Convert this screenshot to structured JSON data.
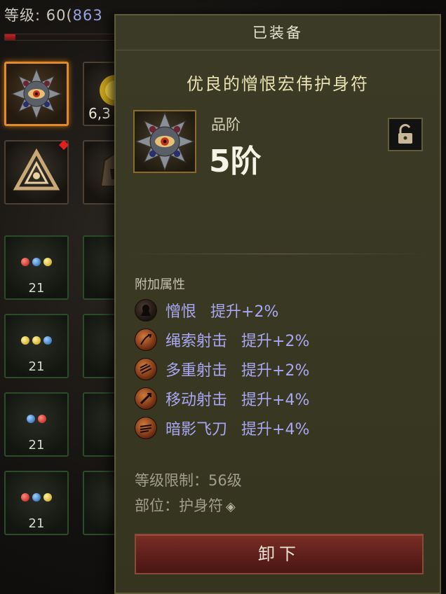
{
  "hud": {
    "level_prefix": "等级: 60(",
    "level_value": "863",
    "xp_progress": 0.09
  },
  "inventory": {
    "gold_amount": "6,3",
    "rows": [
      {
        "level": "21",
        "gems": [
          "red",
          "blue",
          "yellow"
        ]
      },
      {
        "level": "21",
        "gems": [
          "yellow",
          "yellow",
          "blue"
        ]
      },
      {
        "level": "21",
        "gems": [
          "blue",
          "red"
        ]
      },
      {
        "level": "21",
        "gems": [
          "red",
          "blue",
          "yellow"
        ]
      }
    ]
  },
  "tooltip": {
    "header": "已装备",
    "item_title": "优良的憎恨宏伟护身符",
    "rank_label": "品阶",
    "rank_value": "5阶",
    "attributes_heading": "附加属性",
    "attributes": [
      {
        "name": "憎恨",
        "bonus": "提升+2%",
        "icon": "hatred-icon"
      },
      {
        "name": "绳索射击",
        "bonus": "提升+2%",
        "icon": "rope-shot-icon"
      },
      {
        "name": "多重射击",
        "bonus": "提升+2%",
        "icon": "multishot-icon"
      },
      {
        "name": "移动射击",
        "bonus": "提升+4%",
        "icon": "moving-shot-icon"
      },
      {
        "name": "暗影飞刀",
        "bonus": "提升+4%",
        "icon": "shadow-knife-icon"
      }
    ],
    "level_requirement": "等级限制：56级",
    "slot": "部位：护身符",
    "unequip_label": "卸下"
  },
  "colors": {
    "attribute_text": "#a9a6f2",
    "title_text": "#e9e2b5",
    "panel_bg": "#383823",
    "selected_border": "#e08b26"
  }
}
